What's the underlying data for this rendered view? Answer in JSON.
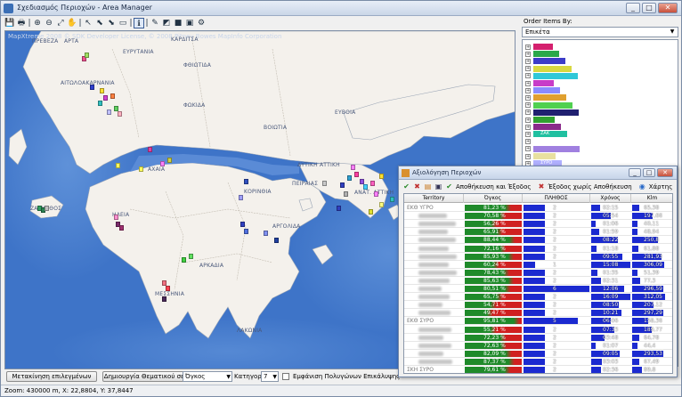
{
  "window": {
    "title": "Σχεδιασμός Περιοχών - Area Manager",
    "controls": [
      "_",
      "□",
      "✕"
    ]
  },
  "toolbar": [
    "💾",
    "🖶",
    "|",
    "⊕",
    "⊖",
    "⤢",
    "✋",
    "|",
    "↖",
    "⬉",
    "⬊",
    "▭",
    "|",
    "ℹ",
    "|",
    "✎",
    "◩",
    "■",
    "▣",
    "⚙"
  ],
  "map": {
    "copyright": "MapXtreme 2008 © SDK Developer License, © 2008 Pitney Bowes MapInfo Corporation",
    "labels": [
      {
        "text": "ΠΡΕΒΕΖΑ"
      },
      {
        "text": "ΑΡΤΑ"
      },
      {
        "text": "ΕΥΡΥΤΑΝΙΑ"
      },
      {
        "text": "ΚΑΡΔΙΤΣΑ"
      },
      {
        "text": "ΦΘΙΩΤΙΔΑ"
      },
      {
        "text": "ΑΙΤΩΛΟΑΚΑΡΝΑΝΙΑ"
      },
      {
        "text": "ΦΩΚΙΔΑ"
      },
      {
        "text": "ΕΥΒΟΙΑ"
      },
      {
        "text": "ΒΟΙΩΤΙΑ"
      },
      {
        "text": "ΔΥΤΙΚΗ ΑΤΤΙΚΗ"
      },
      {
        "text": "ΑΧΑΙΑ"
      },
      {
        "text": "ΚΟΡΙΝΘΙΑ"
      },
      {
        "text": "ΠΕΙΡΑΙΑΣ"
      },
      {
        "text": "ΑΝΑΤ. ΑΤΤΙΚΗ"
      },
      {
        "text": "ΖΑΚΥΝΘΟΣ"
      },
      {
        "text": "ΗΛΕΙΑ"
      },
      {
        "text": "ΑΡΓΟΛΙΔΑ"
      },
      {
        "text": "ΑΡΚΑΔΙΑ"
      },
      {
        "text": "ΜΕΣΣΗΝΙΑ"
      },
      {
        "text": "ΛΑΚΩΝΙΑ"
      }
    ]
  },
  "right_panel": {
    "order_label": "Order Items By:",
    "order_value": "Επικέτα",
    "tree_items": [
      {
        "color": "#d4206e",
        "label": ""
      },
      {
        "color": "#2aa84a",
        "label": ""
      },
      {
        "color": "#3c3cc8",
        "label": ""
      },
      {
        "color": "#d8d840",
        "label": ""
      },
      {
        "color": "#30c8d8",
        "label": ""
      },
      {
        "color": "#c83cc8",
        "label": ""
      },
      {
        "color": "#8a8aff",
        "label": ""
      },
      {
        "color": "#e0a030",
        "label": ""
      },
      {
        "color": "#50d050",
        "label": ""
      },
      {
        "color": "#202070",
        "label": ""
      },
      {
        "color": "#30a030",
        "label": ""
      },
      {
        "color": "#8a2a8a",
        "label": ""
      },
      {
        "color": "#20c0a0",
        "label": "ΖΑΚ"
      },
      {
        "color": "#ffffff",
        "label": ""
      },
      {
        "color": "#a080e0",
        "label": ""
      },
      {
        "color": "#e8e0a0",
        "label": ""
      },
      {
        "color": "#b0b0ff",
        "label": "ΣΥΡΟ"
      },
      {
        "color": "#d09060",
        "label": ""
      },
      {
        "color": "#c0c0c0",
        "label": "ΣΚΗ 2070"
      }
    ]
  },
  "bottom": {
    "move_selected": "Μετακίνηση επιλεγμένων",
    "create_thematic": "Δημιουργία Θεματικού σε:",
    "thematic_field": "Όγκος",
    "categories_label": "Κατηγορίες:",
    "categories_value": "7",
    "show_overlap": "Εμφάνιση Πολυγώνων Επικάλυψης"
  },
  "status": {
    "text": "Zoom: 430000 m, X: 22,8804, Y: 37,8447"
  },
  "dialog": {
    "title": "Αξιολόγηση Περιοχών",
    "save_exit": "Αποθήκευση και Έξοδος",
    "exit_nosave": "Έξοδος χωρίς Αποθήκευση",
    "map_btn": "Χάρτης",
    "columns": [
      "Territory",
      "Όγκος",
      "ΠΛΗΘΟΣ",
      "Χρόνος",
      "Klm"
    ],
    "rows": [
      {
        "territory": "ΕΚΘ ΥΓΡΟ",
        "volume": "81,23 %",
        "v": 0.81,
        "count": "2",
        "c": 0.33,
        "time": "02:15",
        "t": 0.22,
        "klm": "65,38",
        "k": 0.17
      },
      {
        "territory": "",
        "volume": "70,58 %",
        "v": 0.71,
        "count": "2",
        "c": 0.33,
        "time": "05:54",
        "t": 0.5,
        "klm": "197,66",
        "k": 0.5
      },
      {
        "territory": "",
        "volume": "56,26 %",
        "v": 0.56,
        "count": "2",
        "c": 0.33,
        "time": "01:06",
        "t": 0.12,
        "klm": "40,11",
        "k": 0.12
      },
      {
        "territory": "",
        "volume": "65,91 %",
        "v": 0.66,
        "count": "2",
        "c": 0.33,
        "time": "01:59",
        "t": 0.2,
        "klm": "48,94",
        "k": 0.14
      },
      {
        "territory": "",
        "volume": "88,44 %",
        "v": 0.88,
        "count": "2",
        "c": 0.33,
        "time": "08:22",
        "t": 0.68,
        "klm": "250,8",
        "k": 0.64
      },
      {
        "territory": "",
        "volume": "72,16 %",
        "v": 0.72,
        "count": "2",
        "c": 0.33,
        "time": "01:18",
        "t": 0.14,
        "klm": "61,88",
        "k": 0.16
      },
      {
        "territory": "",
        "volume": "85,93 %",
        "v": 0.86,
        "count": "2",
        "c": 0.33,
        "time": "09:55",
        "t": 0.8,
        "klm": "281,93",
        "k": 0.72
      },
      {
        "territory": "",
        "volume": "60,24 %",
        "v": 0.6,
        "count": "1",
        "c": 0.17,
        "time": "15:08",
        "t": 1.0,
        "klm": "306,09",
        "k": 0.78
      },
      {
        "territory": "",
        "volume": "78,43 %",
        "v": 0.78,
        "count": "2",
        "c": 0.33,
        "time": "01:35",
        "t": 0.16,
        "klm": "51,39",
        "k": 0.14
      },
      {
        "territory": "",
        "volume": "85,63 %",
        "v": 0.86,
        "count": "2",
        "c": 0.33,
        "time": "02:31",
        "t": 0.24,
        "klm": "77,3",
        "k": 0.2
      },
      {
        "territory": "",
        "volume": "80,51 %",
        "v": 0.8,
        "count": "6",
        "c": 1.0,
        "time": "12:06",
        "t": 0.85,
        "klm": "296,59",
        "k": 0.76
      },
      {
        "territory": "",
        "volume": "65,75 %",
        "v": 0.66,
        "count": "2",
        "c": 0.33,
        "time": "16:09",
        "t": 1.0,
        "klm": "312,05",
        "k": 0.8
      },
      {
        "territory": "",
        "volume": "54,71 %",
        "v": 0.55,
        "count": "2",
        "c": 0.33,
        "time": "08:50",
        "t": 0.7,
        "klm": "207,12",
        "k": 0.53
      },
      {
        "territory": "",
        "volume": "49,47 %",
        "v": 0.49,
        "count": "2",
        "c": 0.33,
        "time": "10:21",
        "t": 0.78,
        "klm": "297,29",
        "k": 0.76
      },
      {
        "territory": "ΕΚΘ ΣΥΡΟ",
        "volume": "95,81 %",
        "v": 0.96,
        "count": "5",
        "c": 0.83,
        "time": "06:06",
        "t": 0.5,
        "klm": "158,36",
        "k": 0.4
      },
      {
        "territory": "",
        "volume": "55,21 %",
        "v": 0.55,
        "count": "2",
        "c": 0.33,
        "time": "07:33",
        "t": 0.6,
        "klm": "189,77",
        "k": 0.48
      },
      {
        "territory": "",
        "volume": "72,23 %",
        "v": 0.72,
        "count": "2",
        "c": 0.33,
        "time": "03:48",
        "t": 0.33,
        "klm": "64,78",
        "k": 0.17
      },
      {
        "territory": "",
        "volume": "72,63 %",
        "v": 0.73,
        "count": "2",
        "c": 0.33,
        "time": "01:07",
        "t": 0.12,
        "klm": "44,4",
        "k": 0.12
      },
      {
        "territory": "",
        "volume": "82,09 %",
        "v": 0.82,
        "count": "2",
        "c": 0.33,
        "time": "09:05",
        "t": 0.72,
        "klm": "293,53",
        "k": 0.75
      },
      {
        "territory": "",
        "volume": "87,37 %",
        "v": 0.87,
        "count": "2",
        "c": 0.33,
        "time": "03:03",
        "t": 0.28,
        "klm": "67,49",
        "k": 0.18
      },
      {
        "territory": "ΣΚΗ ΣΥΡΟ",
        "volume": "79,61 %",
        "v": 0.8,
        "count": "2",
        "c": 0.33,
        "time": "02:36",
        "t": 0.25,
        "klm": "89,8",
        "k": 0.23
      }
    ],
    "total": {
      "territory": "\"ΣΥΝΟΛΑ\"",
      "volume": "72,77 %",
      "v": 0.73,
      "count": "50",
      "c": 1.0,
      "time": "129:50",
      "t": 1.0,
      "klm": "3.397,87",
      "k": 1.0
    }
  }
}
